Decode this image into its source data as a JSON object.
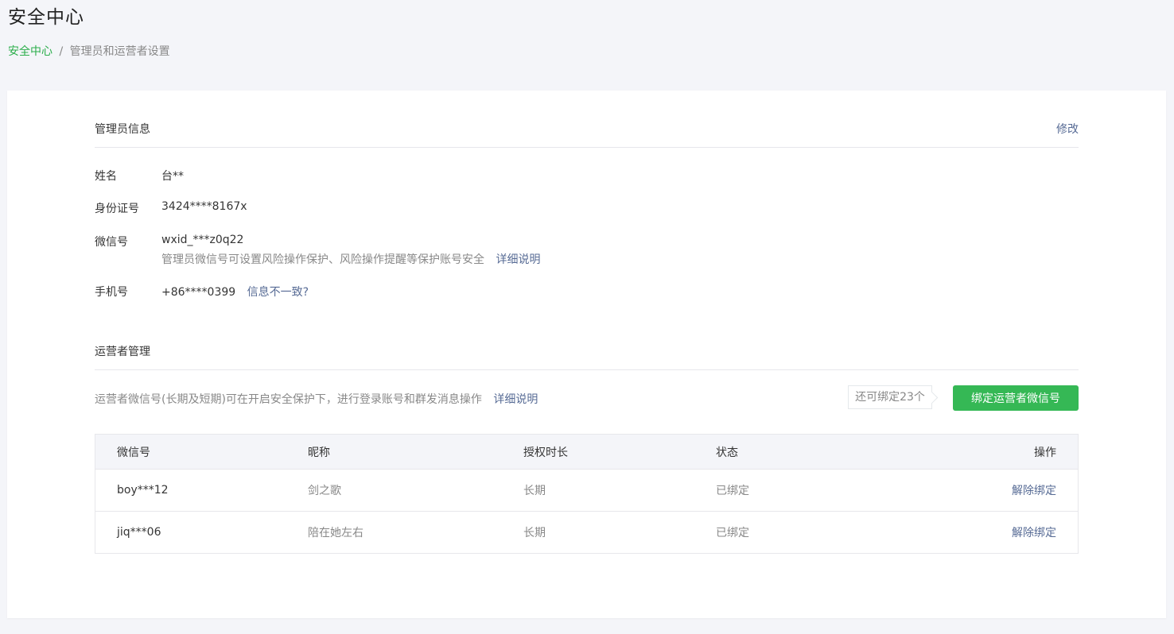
{
  "page": {
    "title": "安全中心",
    "breadcrumb": {
      "home": "安全中心",
      "separator": "/",
      "current": "管理员和运营者设置"
    }
  },
  "admin": {
    "section_title": "管理员信息",
    "edit_label": "修改",
    "fields": {
      "name": {
        "label": "姓名",
        "value": "台**"
      },
      "id_card": {
        "label": "身份证号",
        "value": "3424****8167x"
      },
      "wechat": {
        "label": "微信号",
        "value": "wxid_***z0q22",
        "hint": "管理员微信号可设置风险操作保护、风险操作提醒等保护账号安全",
        "hint_link": "详细说明"
      },
      "phone": {
        "label": "手机号",
        "value": "+86****0399",
        "link": "信息不一致?"
      }
    }
  },
  "operators": {
    "section_title": "运营者管理",
    "description": "运营者微信号(长期及短期)可在开启安全保护下，进行登录账号和群发消息操作",
    "description_link": "详细说明",
    "remaining": "还可绑定23个",
    "bind_button": "绑定运营者微信号",
    "table": {
      "headers": [
        "微信号",
        "昵称",
        "授权时长",
        "状态",
        "操作"
      ],
      "rows": [
        {
          "wechat": "boy***12",
          "nickname": "剑之歌",
          "duration": "长期",
          "status": "已绑定",
          "action": "解除绑定"
        },
        {
          "wechat": "jiq***06",
          "nickname": "陪在她左右",
          "duration": "长期",
          "status": "已绑定",
          "action": "解除绑定"
        }
      ]
    }
  },
  "colors": {
    "accent_green": "#35b855",
    "link_blue": "#576b95",
    "breadcrumb_green": "#2bae4b"
  }
}
